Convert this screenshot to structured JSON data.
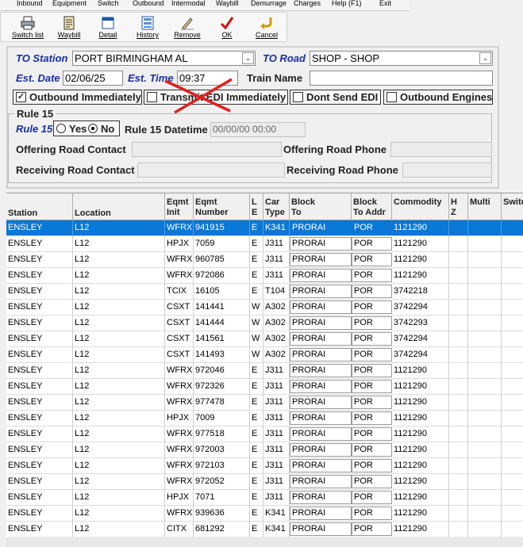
{
  "menu": [
    "Inbound",
    "Equipment",
    "Switch",
    "Outbound",
    "Intermodal",
    "Waybill",
    "Demurrage",
    "Charges",
    "Help (F1)",
    "Exit"
  ],
  "toolbar": [
    {
      "label": "Switch list",
      "icon": "printer-icon"
    },
    {
      "label": "Waybill",
      "icon": "waybill-document-icon"
    },
    {
      "label": "Detail",
      "icon": "detail-window-icon"
    },
    {
      "label": "History",
      "icon": "history-list-icon"
    },
    {
      "label": "Remove",
      "icon": "remove-pencil-icon"
    },
    {
      "label": "OK",
      "icon": "checkmark-icon"
    },
    {
      "label": "Cancel",
      "icon": "cancel-arrow-icon"
    }
  ],
  "form": {
    "to_station_label": "TO Station",
    "to_station_value": "PORT BIRMINGHAM AL",
    "to_road_label": "TO Road",
    "to_road_value": "SHOP - SHOP",
    "est_date_label": "Est. Date",
    "est_date_value": "02/06/25",
    "est_time_label": "Est. Time",
    "est_time_value": "09:37",
    "train_name_label": "Train Name",
    "train_name_value": "",
    "outbound_immediately": {
      "label": "Outbound Immediately",
      "checked": true
    },
    "transmit_edi": {
      "label": "Transmit EDI Immediately",
      "checked": false
    },
    "dont_send_edi": {
      "label": "Dont Send EDI",
      "checked": false
    },
    "outbound_engines": {
      "label": "Outbound Engines",
      "checked": false
    },
    "rule15_group": "Rule 15",
    "rule15_label": "Rule 15",
    "rule15_yes": "Yes",
    "rule15_no": "No",
    "rule15_selected": "No",
    "rule15_datetime_label": "Rule 15 Datetime",
    "rule15_datetime_value": "00/00/00 00:00",
    "offering_contact_label": "Offering Road Contact",
    "offering_phone_label": "Offering Road Phone",
    "receiving_contact_label": "Receiving Road Contact",
    "receiving_phone_label": "Receiving Road Phone"
  },
  "grid": {
    "columns": [
      "Station",
      "Location",
      "Eqmt\nInit",
      "Eqmt\nNumber",
      "L\nE",
      "Car\nType",
      "Block\nTo",
      "Block\nTo Addr",
      "Commodity",
      "H\nZ",
      "Multi",
      "Switch"
    ],
    "rows": [
      [
        "ENSLEY",
        "L12",
        "WFRX",
        "941915",
        "E",
        "K341",
        "PRORAI",
        "POR",
        "1121290",
        "",
        "",
        ""
      ],
      [
        "ENSLEY",
        "L12",
        "HPJX",
        "7059",
        "E",
        "J311",
        "PRORAI",
        "POR",
        "1121290",
        "",
        "",
        ""
      ],
      [
        "ENSLEY",
        "L12",
        "WFRX",
        "960785",
        "E",
        "J311",
        "PRORAI",
        "POR",
        "1121290",
        "",
        "",
        ""
      ],
      [
        "ENSLEY",
        "L12",
        "WFRX",
        "972086",
        "E",
        "J311",
        "PRORAI",
        "POR",
        "1121290",
        "",
        "",
        ""
      ],
      [
        "ENSLEY",
        "L12",
        "TCIX",
        "16105",
        "E",
        "T104",
        "PRORAI",
        "POR",
        "3742218",
        "",
        "",
        ""
      ],
      [
        "ENSLEY",
        "L12",
        "CSXT",
        "141441",
        "W",
        "A302",
        "PRORAI",
        "POR",
        "3742294",
        "",
        "",
        ""
      ],
      [
        "ENSLEY",
        "L12",
        "CSXT",
        "141444",
        "W",
        "A302",
        "PRORAI",
        "POR",
        "3742293",
        "",
        "",
        ""
      ],
      [
        "ENSLEY",
        "L12",
        "CSXT",
        "141561",
        "W",
        "A302",
        "PRORAI",
        "POR",
        "3742294",
        "",
        "",
        ""
      ],
      [
        "ENSLEY",
        "L12",
        "CSXT",
        "141493",
        "W",
        "A302",
        "PRORAI",
        "POR",
        "3742294",
        "",
        "",
        ""
      ],
      [
        "ENSLEY",
        "L12",
        "WFRX",
        "972046",
        "E",
        "J311",
        "PRORAI",
        "POR",
        "1121290",
        "",
        "",
        ""
      ],
      [
        "ENSLEY",
        "L12",
        "WFRX",
        "972326",
        "E",
        "J311",
        "PRORAI",
        "POR",
        "1121290",
        "",
        "",
        ""
      ],
      [
        "ENSLEY",
        "L12",
        "WFRX",
        "977478",
        "E",
        "J311",
        "PRORAI",
        "POR",
        "1121290",
        "",
        "",
        ""
      ],
      [
        "ENSLEY",
        "L12",
        "HPJX",
        "7009",
        "E",
        "J311",
        "PRORAI",
        "POR",
        "1121290",
        "",
        "",
        ""
      ],
      [
        "ENSLEY",
        "L12",
        "WFRX",
        "977518",
        "E",
        "J311",
        "PRORAI",
        "POR",
        "1121290",
        "",
        "",
        ""
      ],
      [
        "ENSLEY",
        "L12",
        "WFRX",
        "972003",
        "E",
        "J311",
        "PRORAI",
        "POR",
        "1121290",
        "",
        "",
        ""
      ],
      [
        "ENSLEY",
        "L12",
        "WFRX",
        "972103",
        "E",
        "J311",
        "PRORAI",
        "POR",
        "1121290",
        "",
        "",
        ""
      ],
      [
        "ENSLEY",
        "L12",
        "WFRX",
        "972052",
        "E",
        "J311",
        "PRORAI",
        "POR",
        "1121290",
        "",
        "",
        ""
      ],
      [
        "ENSLEY",
        "L12",
        "HPJX",
        "7071",
        "E",
        "J311",
        "PRORAI",
        "POR",
        "1121290",
        "",
        "",
        ""
      ],
      [
        "ENSLEY",
        "L12",
        "WFRX",
        "939636",
        "E",
        "K341",
        "PRORAI",
        "POR",
        "1121290",
        "",
        "",
        ""
      ],
      [
        "ENSLEY",
        "L12",
        "CITX",
        "681292",
        "E",
        "K341",
        "PRORAI",
        "POR",
        "1121290",
        "",
        "",
        ""
      ]
    ],
    "selected_row": 0
  },
  "colors": {
    "accent": "#1a2fa0",
    "selection": "#0a78d7",
    "cross": "#e02020"
  }
}
